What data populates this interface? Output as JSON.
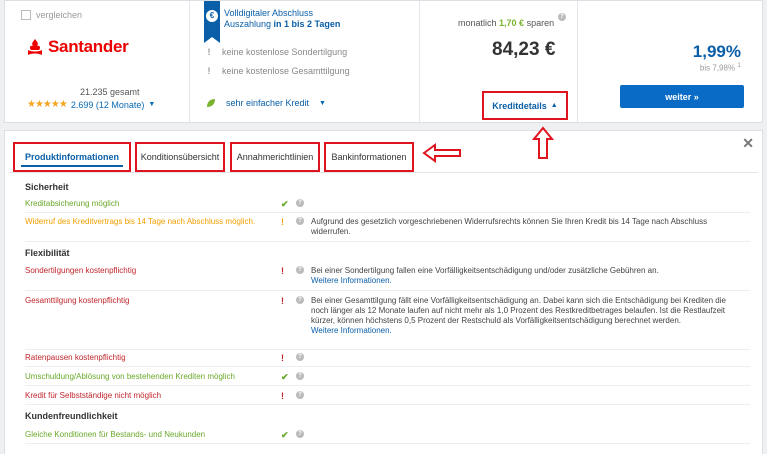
{
  "offer": {
    "compare_label": "vergleichen",
    "bank_name": "Santander",
    "rating_total": "21.235 gesamt",
    "rating_stars": "★★★★★",
    "rating_link": "2.699 (12 Monate)",
    "digital_title": "Volldigitaler Abschluss",
    "digital_sub_prefix": "Auszahlung ",
    "digital_sub_bold": "in 1 bis 2 Tagen",
    "features": [
      {
        "mark": "!",
        "text": "keine kostenlose Sondertilgung"
      },
      {
        "mark": "!",
        "text": "keine kostenlose Gesamttilgung"
      },
      {
        "mark": "leaf",
        "text": "sehr einfacher Kredit"
      }
    ],
    "monthly_prefix": "monatlich ",
    "monthly_saving": "1,70 €",
    "monthly_suffix": " sparen",
    "price": "84,23 €",
    "details_button": "Kreditdetails",
    "rate": "1,99%",
    "rate_sub": "bis 7,98%",
    "rate_footnote": "1",
    "cta_button": "weiter »"
  },
  "tabs": [
    {
      "label": "Produktinformationen",
      "active": true
    },
    {
      "label": "Konditionsübersicht",
      "active": false
    },
    {
      "label": "Annahmerichtlinien",
      "active": false
    },
    {
      "label": "Bankinformationen",
      "active": false
    }
  ],
  "sections": [
    {
      "title": "Sicherheit",
      "rows": [
        {
          "label": "Kreditabsicherung möglich",
          "status": "green",
          "mark": "✔",
          "desc": "",
          "more": ""
        },
        {
          "label": "Widerruf des Kreditvertrags bis 14 Tage nach Abschluss möglich.",
          "status": "orange",
          "mark": "!",
          "desc": "Aufgrund des gesetzlich vorgeschriebenen Widerrufsrechts können Sie Ihren Kredit bis 14 Tage nach Abschluss widerrufen.",
          "more": ""
        }
      ]
    },
    {
      "title": "Flexibilität",
      "rows": [
        {
          "label": "Sondertilgungen kostenpflichtig",
          "status": "red",
          "mark": "!",
          "desc": "Bei einer Sondertilgung fallen eine Vorfälligkeitsentschädigung und/oder zusätzliche Gebühren an.",
          "more": "Weitere Informationen."
        },
        {
          "label": "Gesamttilgung kostenpflichtig",
          "status": "red",
          "mark": "!",
          "desc": "Bei einer Gesamttilgung fällt eine Vorfälligkeitsentschädigung an. Dabei kann sich die Entschädigung bei Krediten die noch länger als 12 Monate laufen auf nicht mehr als 1,0 Prozent des Restkreditbetrages belaufen. Ist die Restlaufzeit kürzer, können höchstens 0,5 Prozent der Restschuld als Vorfälligkeitsentschädigung berechnet werden.",
          "more": "Weitere Informationen."
        },
        {
          "label": "Ratenpausen kostenpflichtig",
          "status": "red",
          "mark": "!",
          "desc": "",
          "more": ""
        },
        {
          "label": "Umschuldung/Ablösung von bestehenden Krediten möglich",
          "status": "green",
          "mark": "✔",
          "desc": "",
          "more": ""
        },
        {
          "label": "Kredit für Selbstständige nicht möglich",
          "status": "red",
          "mark": "!",
          "desc": "",
          "more": ""
        }
      ]
    },
    {
      "title": "Kundenfreundlichkeit",
      "rows": [
        {
          "label": "Gleiche Konditionen für Bestands- und Neukunden",
          "status": "green",
          "mark": "✔",
          "desc": "",
          "more": ""
        }
      ]
    }
  ],
  "icons": {
    "info": "info-icon",
    "close": "close-icon",
    "ribbon": "euro-ribbon-icon"
  },
  "colors": {
    "brand_red": "#ec0000",
    "primary_blue": "#0a5fa8",
    "cta_blue": "#0a6bc6",
    "ok_green": "#6aa82a",
    "warn_orange": "#f0a000",
    "bad_red": "#c0262c",
    "annotation_red": "#e0141e"
  }
}
